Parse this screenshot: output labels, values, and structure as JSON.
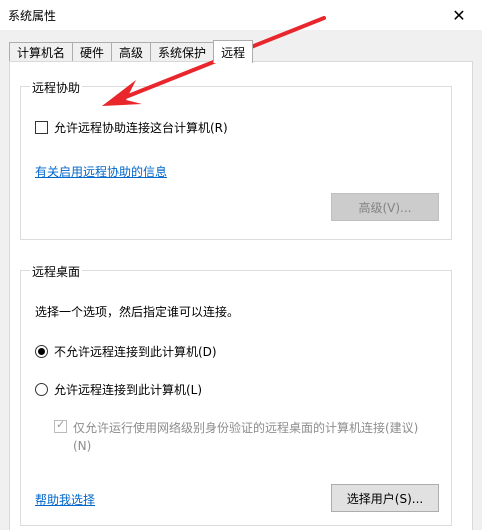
{
  "window": {
    "title": "系统属性",
    "close_glyph": "✕"
  },
  "tabs": [
    {
      "label": "计算机名"
    },
    {
      "label": "硬件"
    },
    {
      "label": "高级"
    },
    {
      "label": "系统保护"
    },
    {
      "label": "远程"
    }
  ],
  "active_tab": "远程",
  "remote_assistance": {
    "title": "远程协助",
    "allow_label": "允许远程协助连接这台计算机(R)",
    "allow_checked": false,
    "info_link": "有关启用远程协助的信息",
    "advanced_button": "高级(V)..."
  },
  "remote_desktop": {
    "title": "远程桌面",
    "instruction": "选择一个选项，然后指定谁可以连接。",
    "option_deny": "不允许远程连接到此计算机(D)",
    "option_allow": "允许远程连接到此计算机(L)",
    "selected_option": "deny",
    "nla_label_line1": "仅允许运行使用网络级别身份验证的远程桌面的计算机连接(建议)",
    "nla_label_line2": "(N)",
    "nla_checked": true,
    "help_link": "帮助我选择",
    "select_users_button": "选择用户(S)..."
  },
  "colors": {
    "annotation_arrow": "#e8262b",
    "link": "#0066cc"
  }
}
